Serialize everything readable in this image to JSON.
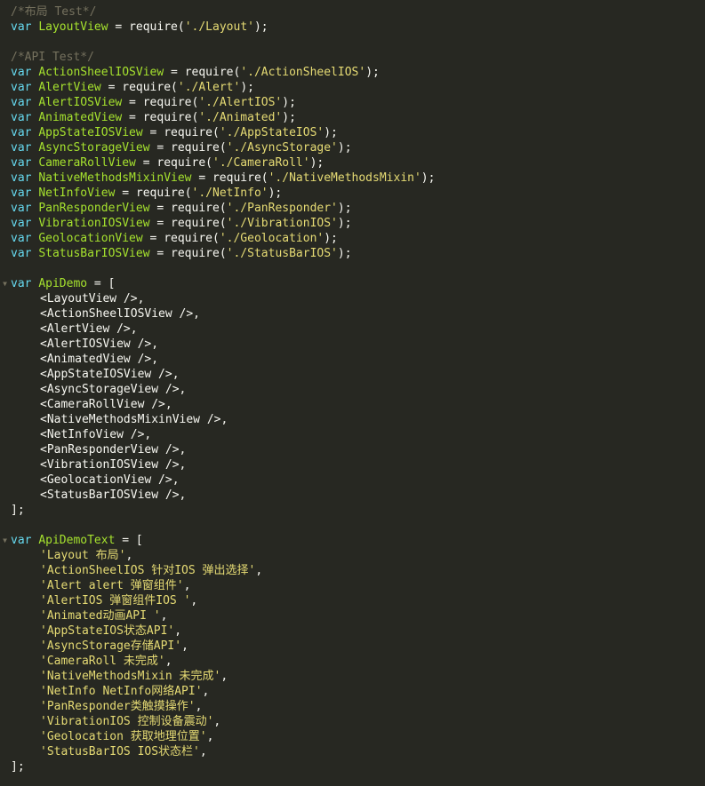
{
  "colors": {
    "background": "#272822",
    "keyword": "#66d9ef",
    "identifier": "#a6e22e",
    "string": "#e6db74",
    "comment": "#75715e",
    "plain": "#f8f8f2"
  },
  "fold_marker_glyph": "▼",
  "keyword": "var",
  "require_fn": "require",
  "comments": {
    "layout": "/*布局 Test*/",
    "api": "/*API Test*/"
  },
  "layout_decl": {
    "name": "LayoutView",
    "path": "'./Layout'"
  },
  "api_decls": [
    {
      "name": "ActionSheelIOSView",
      "path": "'./ActionSheelIOS'"
    },
    {
      "name": "AlertView",
      "path": "'./Alert'"
    },
    {
      "name": "AlertIOSView",
      "path": "'./AlertIOS'"
    },
    {
      "name": "AnimatedView",
      "path": "'./Animated'"
    },
    {
      "name": "AppStateIOSView",
      "path": "'./AppStateIOS'"
    },
    {
      "name": "AsyncStorageView",
      "path": "'./AsyncStorage'"
    },
    {
      "name": "CameraRollView",
      "path": "'./CameraRoll'"
    },
    {
      "name": "NativeMethodsMixinView",
      "path": "'./NativeMethodsMixin'"
    },
    {
      "name": "NetInfoView",
      "path": "'./NetInfo'"
    },
    {
      "name": "PanResponderView",
      "path": "'./PanResponder'"
    },
    {
      "name": "VibrationIOSView",
      "path": "'./VibrationIOS'"
    },
    {
      "name": "GeolocationView",
      "path": "'./Geolocation'"
    },
    {
      "name": "StatusBarIOSView",
      "path": "'./StatusBarIOS'"
    }
  ],
  "api_demo": {
    "name": "ApiDemo",
    "items": [
      "<LayoutView />,",
      "<ActionSheelIOSView />,",
      "<AlertView />,",
      "<AlertIOSView />,",
      "<AnimatedView />,",
      "<AppStateIOSView />,",
      "<AsyncStorageView />,",
      "<CameraRollView />,",
      "<NativeMethodsMixinView />,",
      "<NetInfoView />,",
      "<PanResponderView />,",
      "<VibrationIOSView />,",
      "<GeolocationView />,",
      "<StatusBarIOSView />,"
    ]
  },
  "api_demo_text": {
    "name": "ApiDemoText",
    "items": [
      "'Layout 布局'",
      "'ActionSheelIOS 针对IOS 弹出选择'",
      "'Alert alert 弹窗组件'",
      "'AlertIOS 弹窗组件IOS '",
      "'Animated动画API '",
      "'AppStateIOS状态API'",
      "'AsyncStorage存储API'",
      "'CameraRoll 未完成'",
      "'NativeMethodsMixin 未完成'",
      "'NetInfo NetInfo网络API'",
      "'PanResponder类触摸操作'",
      "'VibrationIOS 控制设备震动'",
      "'Geolocation 获取地理位置'",
      "'StatusBarIOS IOS状态栏'"
    ]
  }
}
